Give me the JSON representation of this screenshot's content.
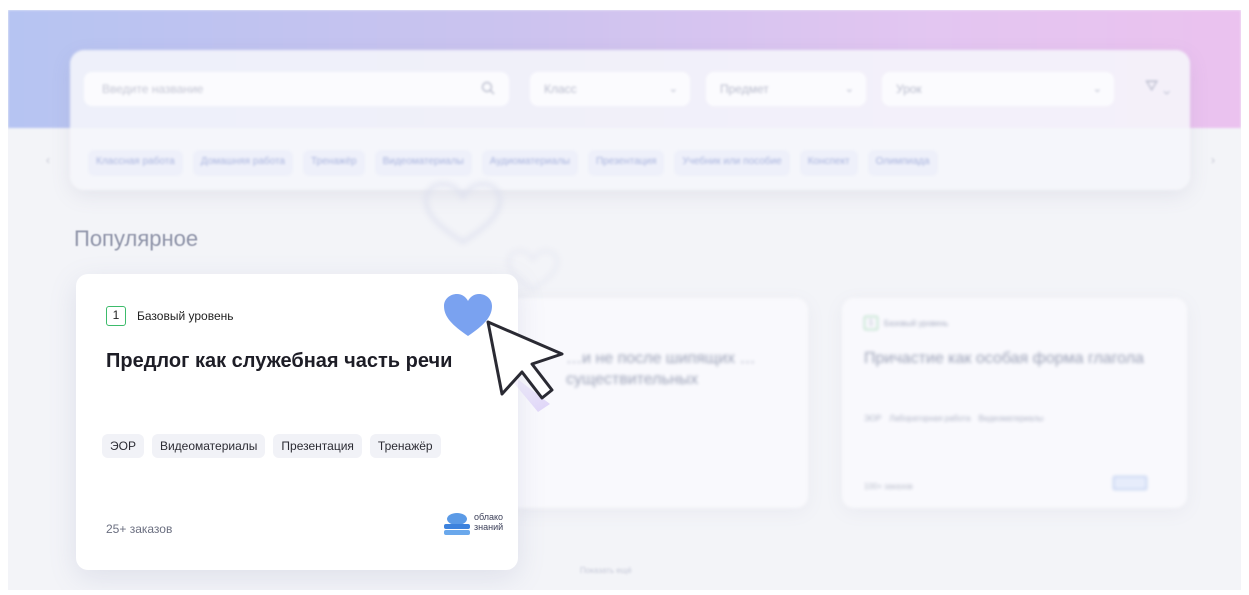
{
  "filters": {
    "search_placeholder": "Введите название",
    "class_select": "Класс",
    "subject_select": "Предмет",
    "lesson_select": "Урок",
    "icons": {
      "search": "search-icon",
      "chevron": "chevron-down-icon",
      "filter": "filter-icon"
    }
  },
  "categories": [
    "Классная работа",
    "Домашняя работа",
    "Тренажёр",
    "Видеоматериалы",
    "Аудиоматериалы",
    "Презентация",
    "Учебник или пособие",
    "Конспект",
    "Олимпиада"
  ],
  "section": {
    "title": "Популярное"
  },
  "featured_card": {
    "level_number": "1",
    "level_label": "Базовый уровень",
    "title": "Предлог как служебная часть речи",
    "tags": [
      "ЭОР",
      "Видеоматериалы",
      "Презентация",
      "Тренажёр"
    ],
    "orders": "25+ заказов",
    "favorite": true,
    "logo_text": "облако знаний",
    "accent_color": "#7aa2f0"
  },
  "background_cards": [
    {
      "title_partial": "…и не после шипящих … существительных"
    },
    {
      "level_number": "1",
      "level_label": "Базовый уровень",
      "title": "Причастие как особая форма глагола",
      "tags": [
        "ЭОР",
        "Лабораторная работа",
        "Видеоматериалы"
      ],
      "orders": "100+ заказов"
    }
  ],
  "pager_text": "Показать ещё"
}
